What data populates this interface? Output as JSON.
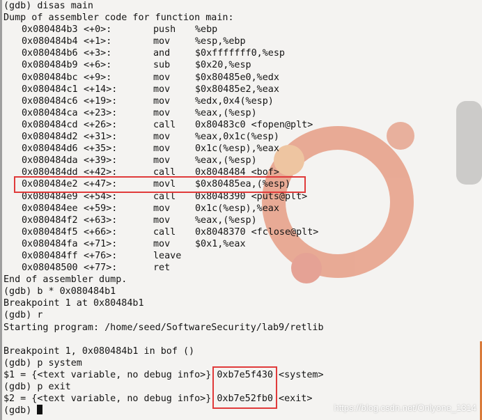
{
  "assembler_header": {
    "command": "(gdb) disas main",
    "title": "Dump of assembler code for function main:"
  },
  "assembly": [
    {
      "addr": "0x080484b3",
      "offset": "<+0>:",
      "mnemonic": "push",
      "operands": "%ebp"
    },
    {
      "addr": "0x080484b4",
      "offset": "<+1>:",
      "mnemonic": "mov",
      "operands": "%esp,%ebp"
    },
    {
      "addr": "0x080484b6",
      "offset": "<+3>:",
      "mnemonic": "and",
      "operands": "$0xfffffff0,%esp"
    },
    {
      "addr": "0x080484b9",
      "offset": "<+6>:",
      "mnemonic": "sub",
      "operands": "$0x20,%esp"
    },
    {
      "addr": "0x080484bc",
      "offset": "<+9>:",
      "mnemonic": "mov",
      "operands": "$0x80485e0,%edx"
    },
    {
      "addr": "0x080484c1",
      "offset": "<+14>:",
      "mnemonic": "mov",
      "operands": "$0x80485e2,%eax"
    },
    {
      "addr": "0x080484c6",
      "offset": "<+19>:",
      "mnemonic": "mov",
      "operands": "%edx,0x4(%esp)"
    },
    {
      "addr": "0x080484ca",
      "offset": "<+23>:",
      "mnemonic": "mov",
      "operands": "%eax,(%esp)"
    },
    {
      "addr": "0x080484cd",
      "offset": "<+26>:",
      "mnemonic": "call",
      "operands": "0x80483c0 <fopen@plt>"
    },
    {
      "addr": "0x080484d2",
      "offset": "<+31>:",
      "mnemonic": "mov",
      "operands": "%eax,0x1c(%esp)"
    },
    {
      "addr": "0x080484d6",
      "offset": "<+35>:",
      "mnemonic": "mov",
      "operands": "0x1c(%esp),%eax"
    },
    {
      "addr": "0x080484da",
      "offset": "<+39>:",
      "mnemonic": "mov",
      "operands": "%eax,(%esp)"
    },
    {
      "addr": "0x080484dd",
      "offset": "<+42>:",
      "mnemonic": "call",
      "operands": "0x8048484 <bof>"
    },
    {
      "addr": "0x080484e2",
      "offset": "<+47>:",
      "mnemonic": "movl",
      "operands": "$0x80485ea,(%esp)",
      "highlighted": true
    },
    {
      "addr": "0x080484e9",
      "offset": "<+54>:",
      "mnemonic": "call",
      "operands": "0x8048390 <puts@plt>"
    },
    {
      "addr": "0x080484ee",
      "offset": "<+59>:",
      "mnemonic": "mov",
      "operands": "0x1c(%esp),%eax"
    },
    {
      "addr": "0x080484f2",
      "offset": "<+63>:",
      "mnemonic": "mov",
      "operands": "%eax,(%esp)"
    },
    {
      "addr": "0x080484f5",
      "offset": "<+66>:",
      "mnemonic": "call",
      "operands": "0x8048370 <fclose@plt>"
    },
    {
      "addr": "0x080484fa",
      "offset": "<+71>:",
      "mnemonic": "mov",
      "operands": "$0x1,%eax"
    },
    {
      "addr": "0x080484ff",
      "offset": "<+76>:",
      "mnemonic": "leave",
      "operands": ""
    },
    {
      "addr": "0x08048500",
      "offset": "<+77>:",
      "mnemonic": "ret",
      "operands": ""
    }
  ],
  "session": {
    "end_dump": "End of assembler dump.",
    "break_cmd": "(gdb) b * 0x080484b1",
    "breakpoint_set": "Breakpoint 1 at 0x80484b1",
    "run_cmd": "(gdb) r",
    "starting": "Starting program: /home/seed/SoftwareSecurity/lab9/retlib",
    "blank": "",
    "breakpoint_hit": "Breakpoint 1, 0x080484b1 in bof ()",
    "p_system_cmd": "(gdb) p system",
    "system_result_prefix": "$1 = {<text variable, no debug info>} ",
    "system_addr": "0xb7e5f430",
    "system_symbol": " <system>",
    "p_exit_cmd": "(gdb) p exit",
    "exit_result_prefix": "$2 = {<text variable, no debug info>} ",
    "exit_addr": "0xb7e52fb0",
    "exit_symbol": " <exit>",
    "prompt": "(gdb) "
  },
  "watermark": "https://blog.csdn.net/Onlyone_1314",
  "colors": {
    "highlight_box": "#e03a3a",
    "terminal_bg": "#f4f3f1",
    "text": "#141414"
  }
}
